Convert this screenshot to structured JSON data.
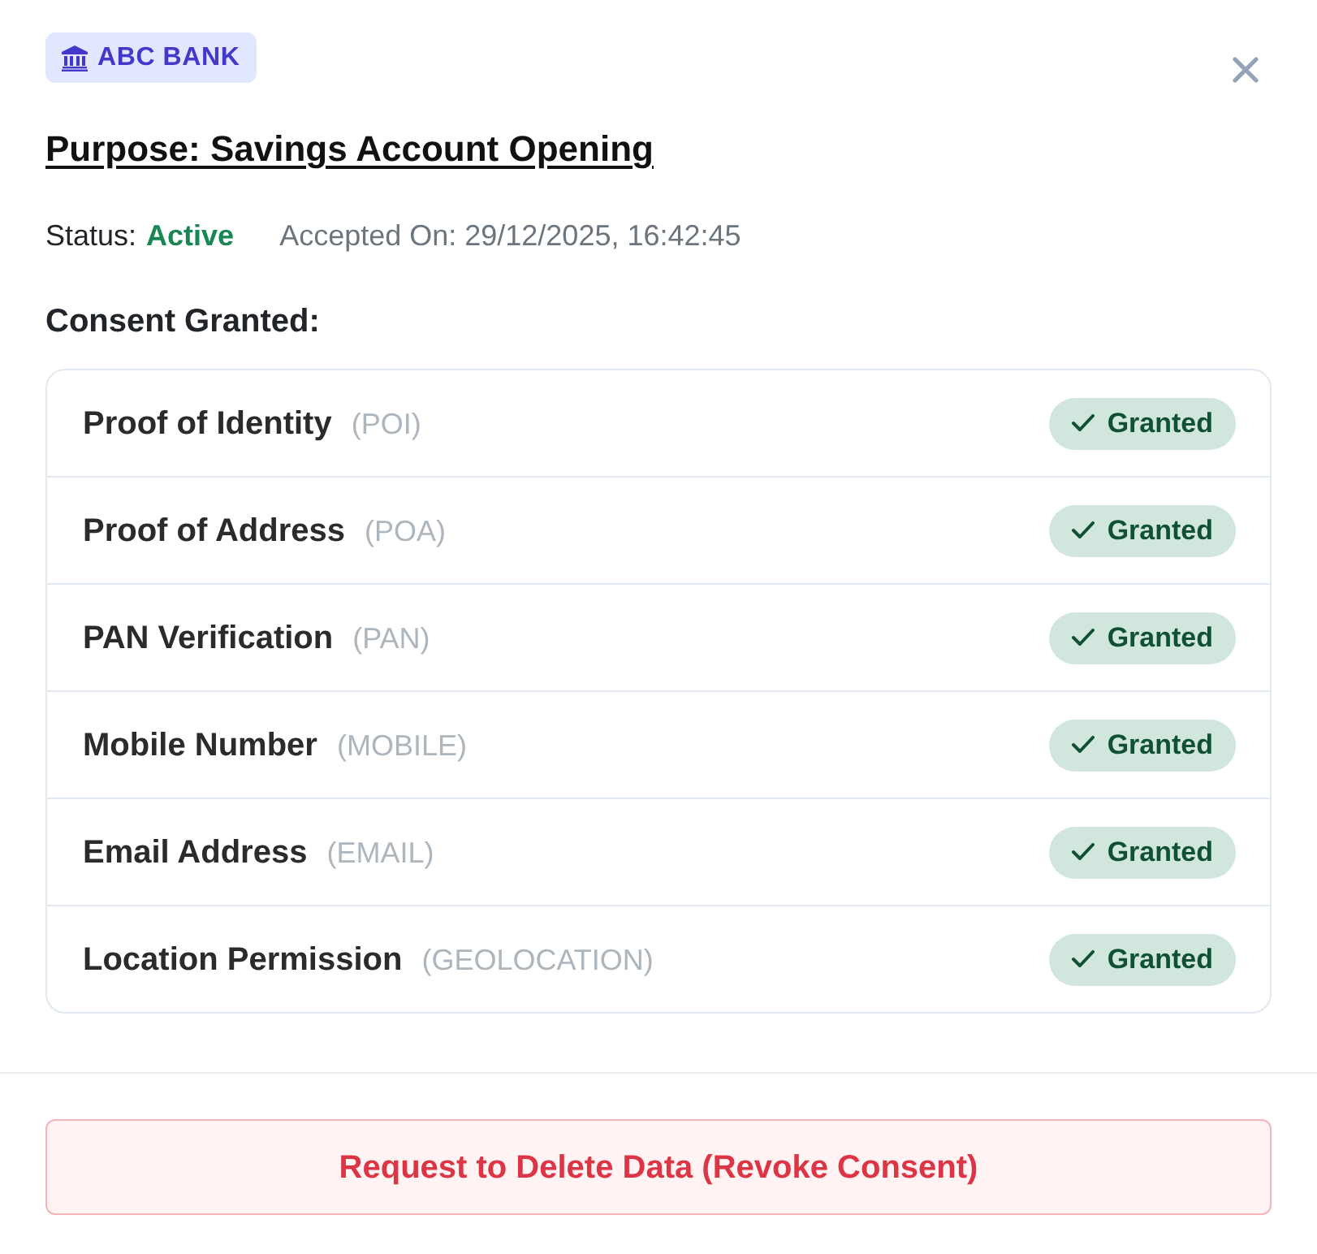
{
  "bank": {
    "name": "ABC BANK"
  },
  "purpose": "Purpose: Savings Account Opening",
  "status": {
    "label": "Status:",
    "value": "Active",
    "active": true
  },
  "accepted_on": "Accepted On: 29/12/2025, 16:42:45",
  "consents_heading": "Consent Granted:",
  "consents": [
    {
      "name": "Proof of Identity",
      "code": "(POI)",
      "granted": true,
      "badge": "Granted"
    },
    {
      "name": "Proof of Address",
      "code": "(POA)",
      "granted": true,
      "badge": "Granted"
    },
    {
      "name": "PAN Verification",
      "code": "(PAN)",
      "granted": true,
      "badge": "Granted"
    },
    {
      "name": "Mobile Number",
      "code": "(MOBILE)",
      "granted": true,
      "badge": "Granted"
    },
    {
      "name": "Email Address",
      "code": "(EMAIL)",
      "granted": true,
      "badge": "Granted"
    },
    {
      "name": "Location Permission",
      "code": "(GEOLOCATION)",
      "granted": true,
      "badge": "Granted"
    }
  ],
  "revoke_button": "Request to Delete Data (Revoke Consent)"
}
